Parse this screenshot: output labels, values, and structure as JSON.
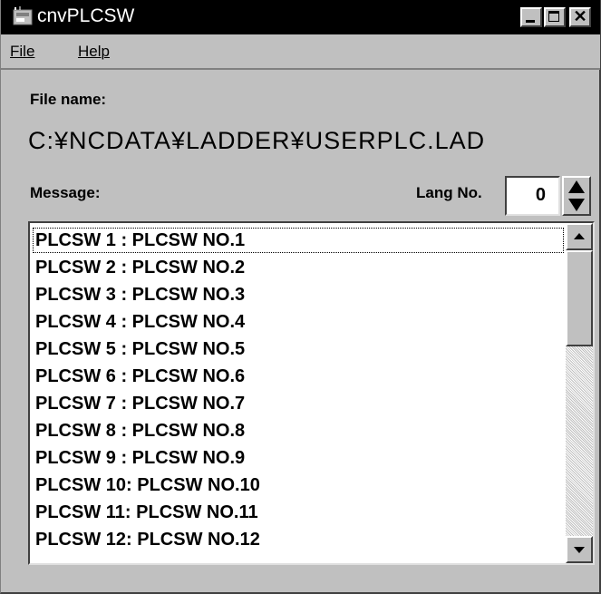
{
  "window": {
    "title": "cnvPLCSW",
    "controls": [
      "minimize",
      "maximize",
      "close"
    ]
  },
  "menu": {
    "file": "File",
    "help": "Help"
  },
  "form": {
    "file_name_label": "File name:",
    "file_path": "C:¥NCDATA¥LADDER¥USERPLC.LAD",
    "message_label": "Message:",
    "lang_label": "Lang No.",
    "lang_value": "0"
  },
  "messages": [
    "PLCSW 1 : PLCSW NO.1",
    "PLCSW 2 : PLCSW NO.2",
    "PLCSW 3 : PLCSW NO.3",
    "PLCSW 4 : PLCSW NO.4",
    "PLCSW 5 : PLCSW NO.5",
    "PLCSW 6 : PLCSW NO.6",
    "PLCSW 7 : PLCSW NO.7",
    "PLCSW 8 : PLCSW NO.8",
    "PLCSW 9 : PLCSW NO.9",
    "PLCSW 10: PLCSW NO.10",
    "PLCSW 11: PLCSW NO.11",
    "PLCSW 12: PLCSW NO.12"
  ],
  "icons": {
    "app": "app-icon",
    "minimize": "minimize-icon",
    "maximize": "maximize-icon",
    "close": "close-icon",
    "spin_up": "spin-up-arrow-icon",
    "spin_down": "spin-down-arrow-icon",
    "scroll_up": "scroll-up-arrow-icon",
    "scroll_down": "scroll-down-arrow-icon"
  },
  "colors": {
    "title_bar": "#000000",
    "face": "#c0c0c0",
    "field": "#ffffff"
  }
}
